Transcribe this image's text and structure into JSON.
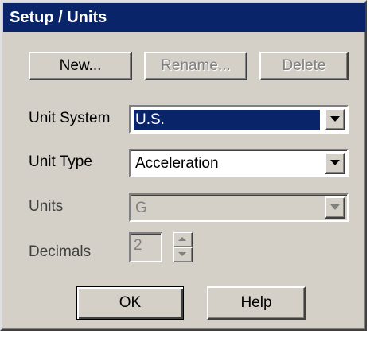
{
  "window": {
    "title": "Setup / Units"
  },
  "toolbar": {
    "new_label": "New...",
    "rename_label": "Rename...",
    "delete_label": "Delete"
  },
  "fields": {
    "unit_system": {
      "label": "Unit System",
      "value": "U.S."
    },
    "unit_type": {
      "label": "Unit Type",
      "value": "Acceleration"
    },
    "units": {
      "label": "Units",
      "value": "G"
    },
    "decimals": {
      "label": "Decimals",
      "value": "2"
    }
  },
  "footer": {
    "ok_label": "OK",
    "help_label": "Help"
  },
  "icons": {
    "dropdown": "chevron-down-icon",
    "spin_up": "spin-up-icon",
    "spin_down": "spin-down-icon"
  },
  "colors": {
    "titlebar": "#0a246a",
    "face": "#d4d0c8",
    "selection": "#0a246a",
    "disabled_text": "#808080"
  }
}
